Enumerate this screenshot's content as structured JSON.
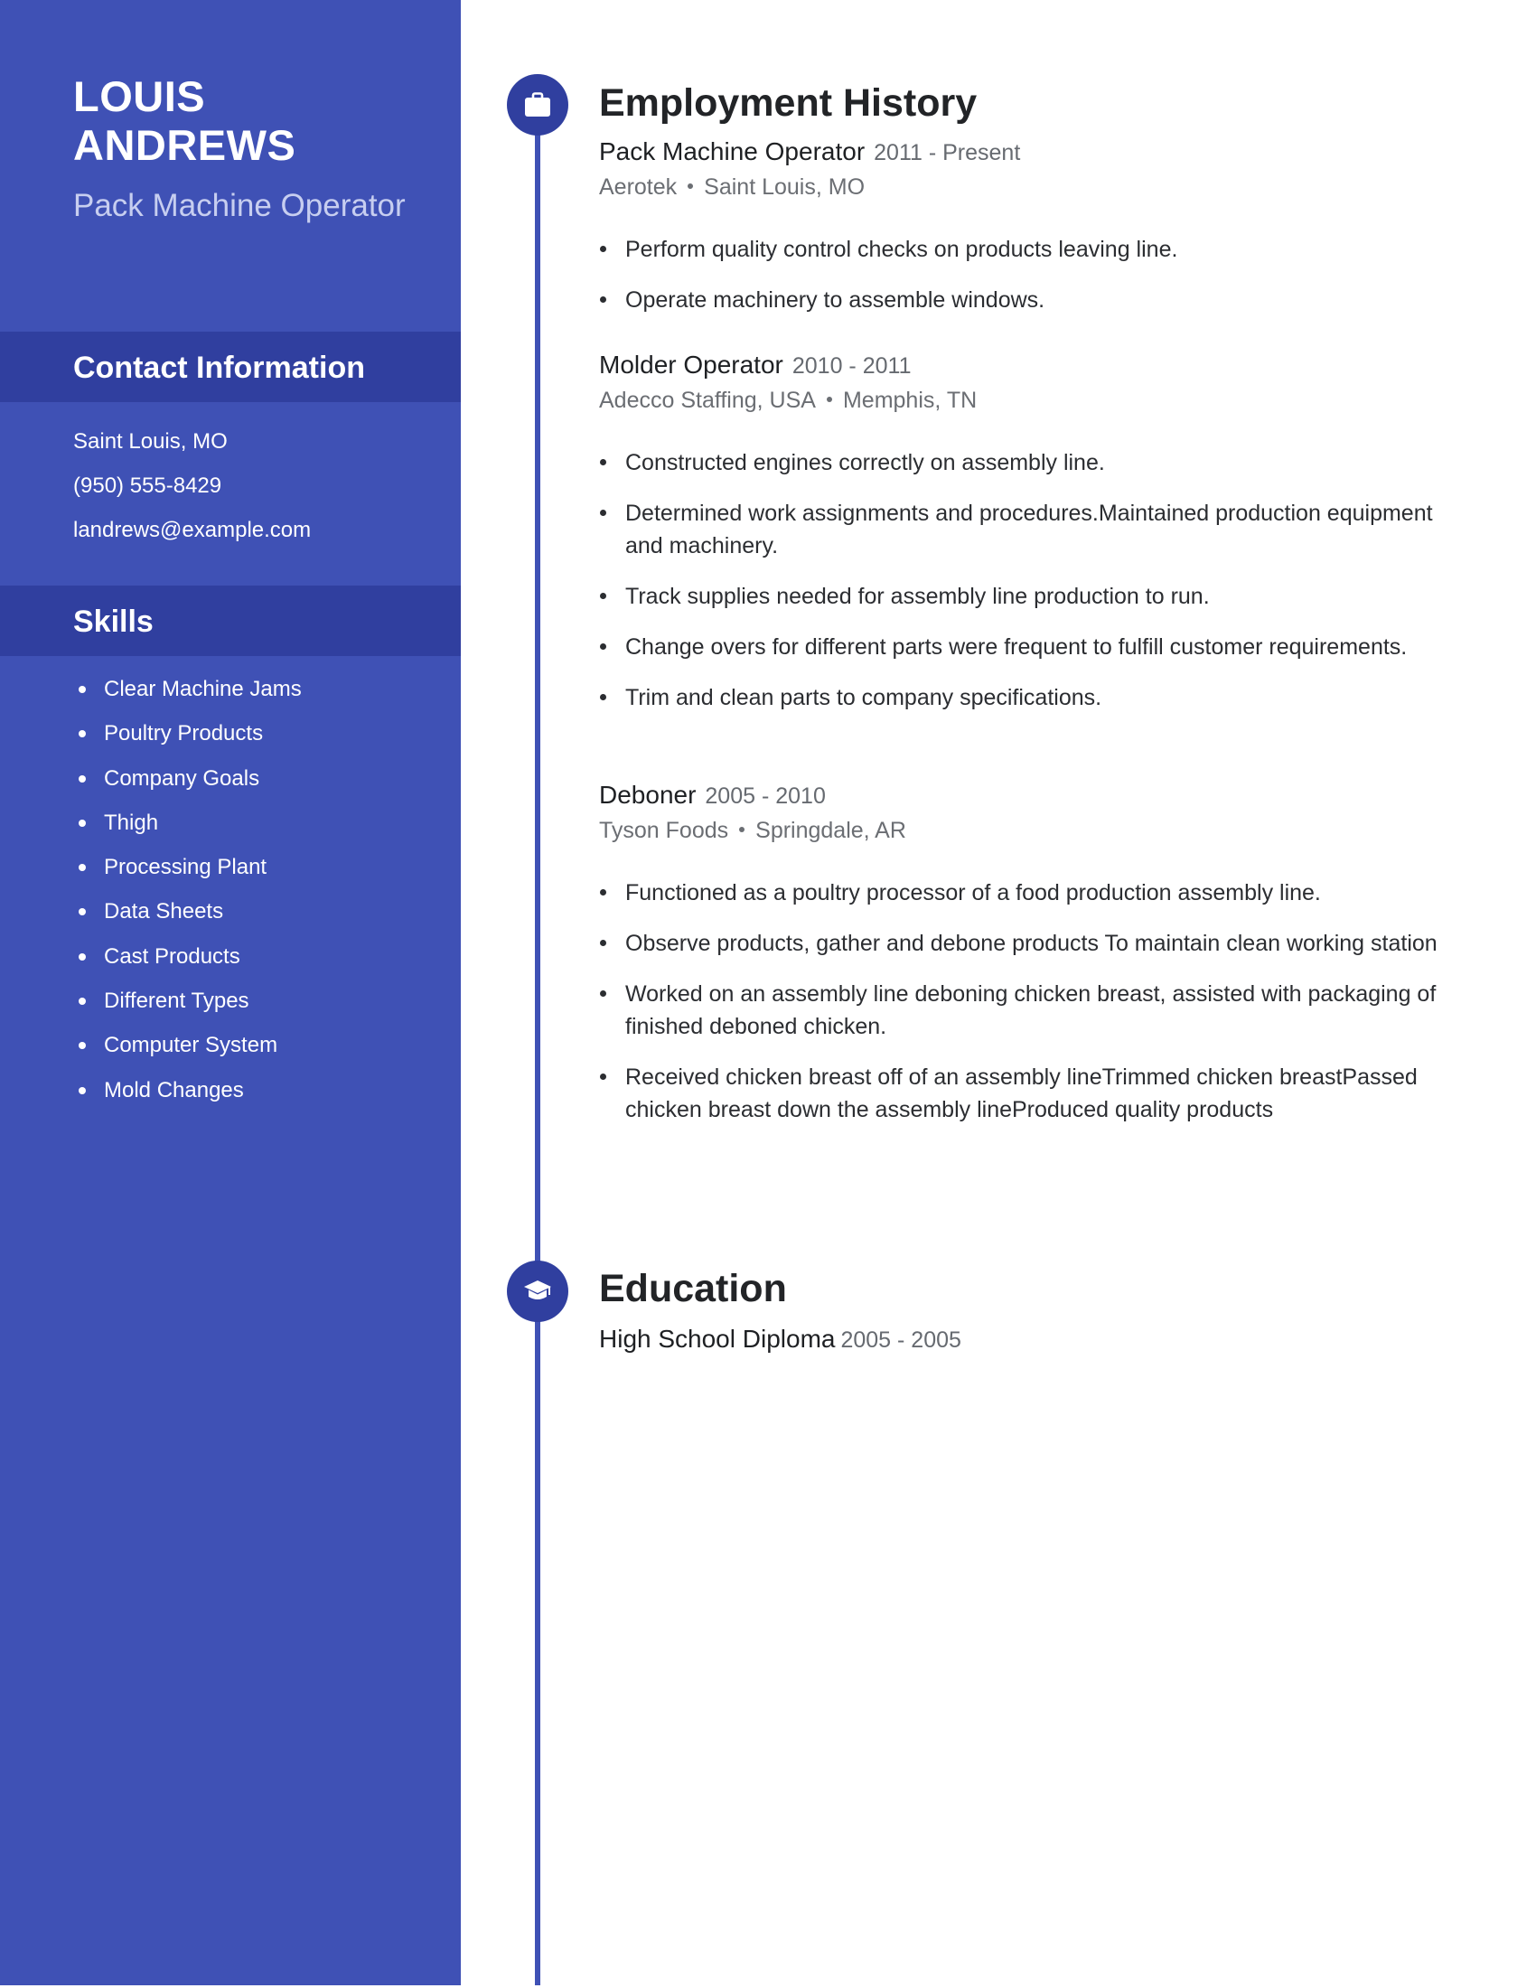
{
  "colors": {
    "sidebar": "#3F51B5",
    "sidebar_band": "#303F9F",
    "accent": "#3F51B5",
    "text": "#222427",
    "muted": "#666A70"
  },
  "profile": {
    "name": "LOUIS ANDREWS",
    "title": "Pack Machine Operator"
  },
  "contact": {
    "heading": "Contact Information",
    "items": [
      "Saint Louis, MO",
      "(950) 555-8429",
      "landrews@example.com"
    ]
  },
  "skills": {
    "heading": "Skills",
    "items": [
      "Clear Machine Jams",
      "Poultry Products",
      "Company Goals",
      "Thigh",
      "Processing Plant",
      "Data Sheets",
      "Cast Products",
      "Different Types",
      "Computer System",
      "Mold Changes"
    ]
  },
  "employment": {
    "heading": "Employment History",
    "icon": "briefcase-icon",
    "jobs": [
      {
        "role": "Pack Machine Operator",
        "dates": "2011 - Present",
        "company": "Aerotek",
        "location": "Saint Louis, MO",
        "bullets": [
          "Perform quality control checks on products leaving line.",
          "Operate machinery to assemble windows."
        ]
      },
      {
        "role": "Molder Operator",
        "dates": "2010 - 2011",
        "company": "Adecco Staffing, USA",
        "location": "Memphis, TN",
        "bullets": [
          "Constructed engines correctly on assembly line.",
          "Determined work assignments and procedures.Maintained production equipment and machinery.",
          "Track supplies needed for assembly line production to run.",
          "Change overs for different parts were frequent to fulfill customer requirements.",
          "Trim and clean parts to company specifications."
        ]
      },
      {
        "role": "Deboner",
        "dates": "2005 - 2010",
        "company": "Tyson Foods",
        "location": "Springdale, AR",
        "bullets": [
          "Functioned as a poultry processor of a food production assembly line.",
          "Observe products, gather and debone products To maintain clean working station",
          "Worked on an assembly line deboning chicken breast, assisted with packaging of finished deboned chicken.",
          "Received chicken breast off of an assembly lineTrimmed chicken breastPassed chicken breast down the assembly lineProduced quality products"
        ]
      }
    ]
  },
  "education": {
    "heading": "Education",
    "icon": "graduation-cap-icon",
    "entries": [
      {
        "degree": "High School Diploma",
        "dates": "2005 - 2005"
      }
    ]
  }
}
